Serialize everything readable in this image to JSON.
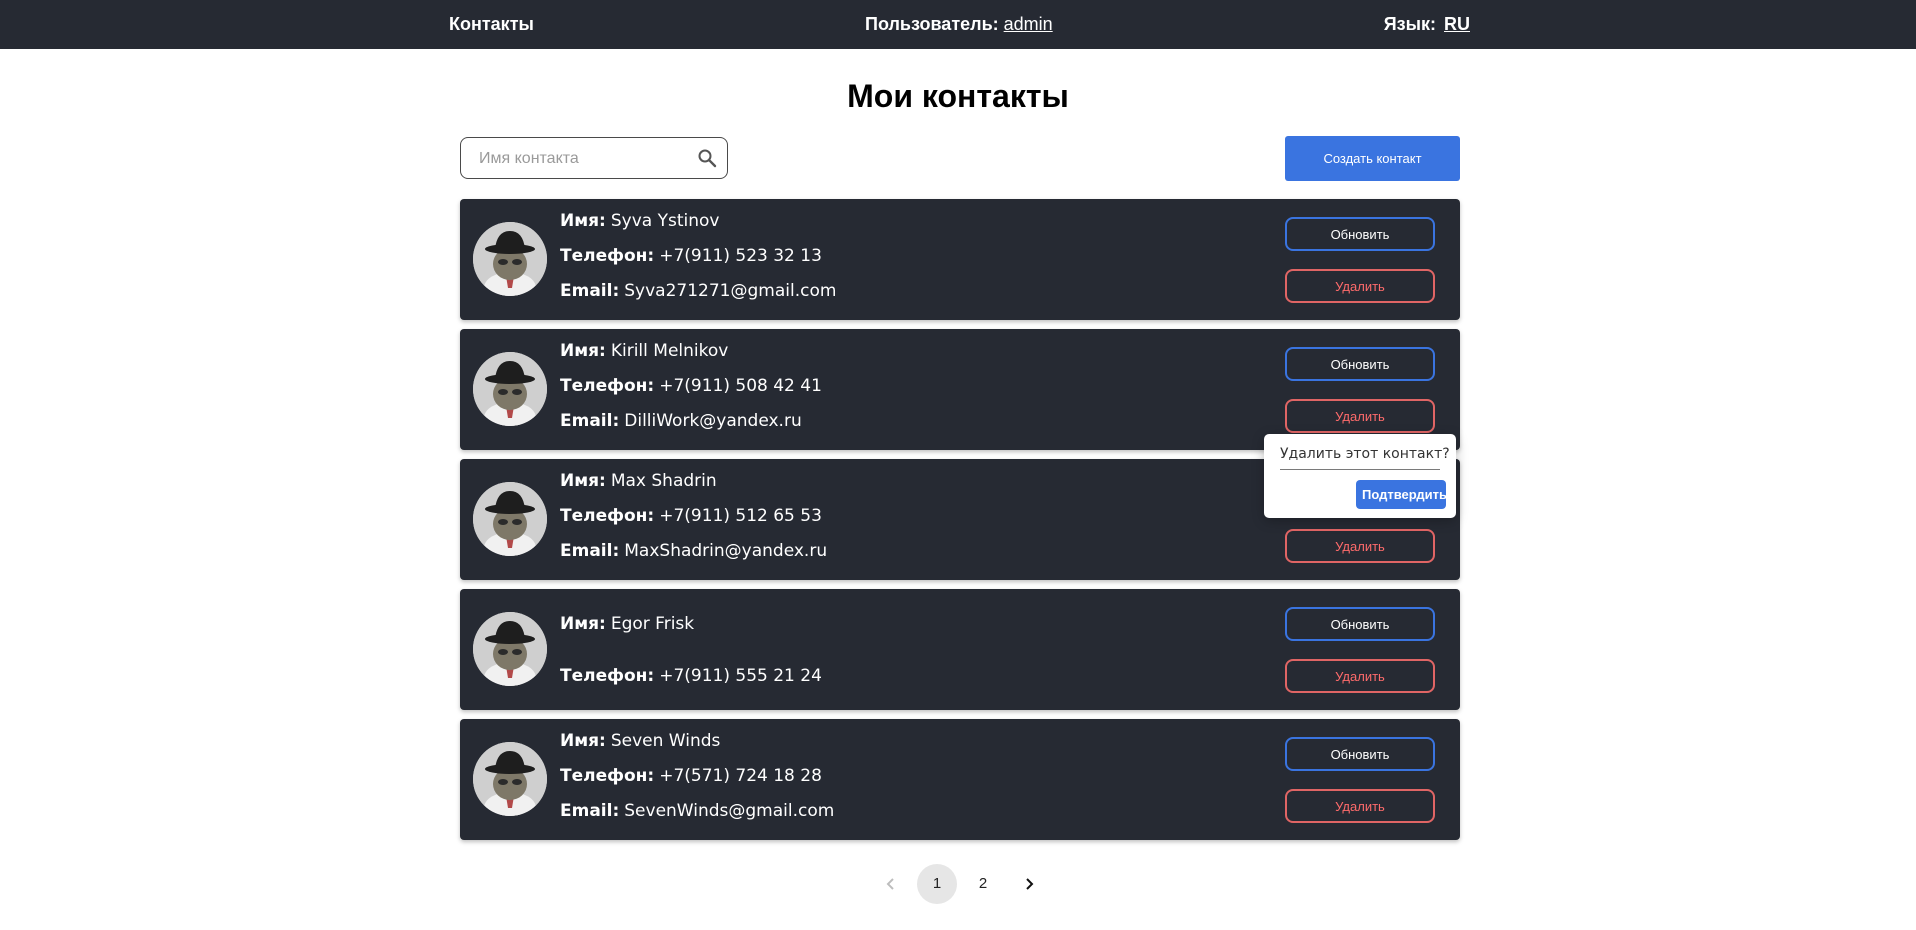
{
  "header": {
    "brand": "Контакты",
    "user_label": "Пользователь:",
    "user_name": "admin",
    "lang_label": "Язык:",
    "lang_value": "RU"
  },
  "page": {
    "title": "Мои контакты"
  },
  "search": {
    "placeholder": "Имя контакта",
    "value": ""
  },
  "toolbar": {
    "create_label": "Создать контакт"
  },
  "labels": {
    "name": "Имя:",
    "phone": "Телефон:",
    "email": "Email:",
    "update": "Обновить",
    "delete": "Удалить"
  },
  "contacts": [
    {
      "name": "Syva Ystinov",
      "phone": "+7(911) 523 32 13",
      "email": "Syva271271@gmail.com"
    },
    {
      "name": "Kirill Melnikov",
      "phone": "+7(911) 508 42 41",
      "email": "DilliWork@yandex.ru"
    },
    {
      "name": "Max Shadrin",
      "phone": "+7(911) 512 65 53",
      "email": "MaxShadrin@yandex.ru"
    },
    {
      "name": "Egor Frisk",
      "phone": "+7(911) 555 21 24",
      "email": ""
    },
    {
      "name": "Seven Winds",
      "phone": "+7(571) 724 18 28",
      "email": "SevenWinds@gmail.com"
    }
  ],
  "popconfirm": {
    "message": "Удалить этот контакт?",
    "confirm_label": "Подтвердить"
  },
  "pagination": {
    "pages": [
      "1",
      "2"
    ],
    "current": "1"
  },
  "colors": {
    "nav_bg": "#262a33",
    "card_bg": "#262a33",
    "accent": "#3a74e0",
    "danger": "#e06565"
  }
}
